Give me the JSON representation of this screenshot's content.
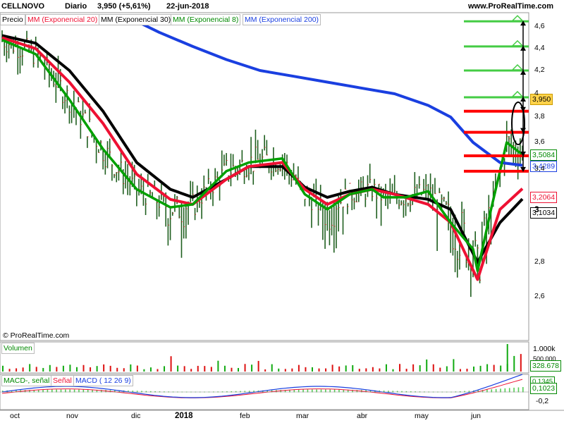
{
  "header": {
    "ticker": "CELLNOVO",
    "period": "Diario",
    "quote": "3,950 (+5,61%)",
    "date": "22-jun-2018",
    "site": "www.ProRealTime.com",
    "copyright": "© ProRealTime.com"
  },
  "legend": {
    "price_label": "Precio",
    "ema20": "MM (Exponencial 20)",
    "ema30": "MM (Exponencial 30)",
    "ema8": "MM (Exponencial 8)",
    "ema200": "MM (Exponencial 200)"
  },
  "volume_pane": {
    "label": "Volumen",
    "ticks": [
      "1.000k",
      "500.000"
    ],
    "last_value": "328.678"
  },
  "macd_pane": {
    "label_macd": "MACD-, señal",
    "label_signal": "Señal",
    "label_params": "MACD ( 12 26 9)",
    "ticks": [
      "-0,2"
    ],
    "value_macd": "0,1345",
    "value_signal": "0,1023"
  },
  "price_labels": {
    "last": "3,950",
    "ema8": "3,5084",
    "ema200": "3,4289",
    "ema20": "3,2064",
    "ema30": "3,1034"
  },
  "colors": {
    "ema8": "#00a000",
    "ema20": "#ee1133",
    "ema30": "#000000",
    "ema200": "#1a3fe0",
    "candles": "#1f5f1f",
    "level_support": "#ff0000",
    "level_target": "#44cc44",
    "last_bg": "#ffd24a"
  },
  "chart_data": {
    "type": "line",
    "x_labels": [
      "oct",
      "nov",
      "dic",
      "2018",
      "feb",
      "mar",
      "abr",
      "may",
      "jun"
    ],
    "y_ticks": [
      "4,6",
      "4,4",
      "4,2",
      "4",
      "3,8",
      "3,6",
      "3,4",
      "3",
      "2,8",
      "2,6"
    ],
    "ylim": [
      2.4,
      4.7
    ],
    "series": [
      {
        "name": "MM (Exponencial 8)",
        "points": [
          [
            0,
            4.48
          ],
          [
            15,
            4.35
          ],
          [
            30,
            3.95
          ],
          [
            45,
            3.55
          ],
          [
            60,
            3.2
          ],
          [
            75,
            3.02
          ],
          [
            85,
            3.05
          ],
          [
            100,
            3.38
          ],
          [
            110,
            3.45
          ],
          [
            125,
            3.48
          ],
          [
            135,
            3.15
          ],
          [
            145,
            3.0
          ],
          [
            155,
            3.15
          ],
          [
            165,
            3.2
          ],
          [
            170,
            3.12
          ],
          [
            180,
            3.12
          ],
          [
            190,
            3.18
          ],
          [
            200,
            2.95
          ],
          [
            210,
            2.85
          ],
          [
            212,
            2.75
          ],
          [
            218,
            3.0
          ],
          [
            225,
            3.6
          ],
          [
            232,
            3.5084
          ]
        ]
      },
      {
        "name": "MM (Exponencial 20)",
        "points": [
          [
            0,
            4.5
          ],
          [
            15,
            4.4
          ],
          [
            30,
            4.1
          ],
          [
            45,
            3.75
          ],
          [
            60,
            3.35
          ],
          [
            75,
            3.1
          ],
          [
            85,
            3.05
          ],
          [
            100,
            3.3
          ],
          [
            110,
            3.42
          ],
          [
            125,
            3.45
          ],
          [
            135,
            3.2
          ],
          [
            145,
            3.05
          ],
          [
            155,
            3.15
          ],
          [
            165,
            3.2
          ],
          [
            175,
            3.15
          ],
          [
            190,
            3.05
          ],
          [
            200,
            2.95
          ],
          [
            212,
            2.7
          ],
          [
            222,
            3.0
          ],
          [
            232,
            3.2064
          ]
        ]
      },
      {
        "name": "MM (Exponencial 30)",
        "points": [
          [
            0,
            4.52
          ],
          [
            15,
            4.45
          ],
          [
            30,
            4.2
          ],
          [
            45,
            3.85
          ],
          [
            60,
            3.45
          ],
          [
            75,
            3.2
          ],
          [
            85,
            3.12
          ],
          [
            100,
            3.3
          ],
          [
            110,
            3.42
          ],
          [
            125,
            3.42
          ],
          [
            135,
            3.22
          ],
          [
            145,
            3.12
          ],
          [
            155,
            3.18
          ],
          [
            165,
            3.22
          ],
          [
            175,
            3.15
          ],
          [
            190,
            3.1
          ],
          [
            200,
            3.0
          ],
          [
            212,
            2.8
          ],
          [
            222,
            2.95
          ],
          [
            232,
            3.1034
          ]
        ]
      },
      {
        "name": "MM (Exponencial 200)",
        "points": [
          [
            55,
            4.7
          ],
          [
            70,
            4.55
          ],
          [
            85,
            4.42
          ],
          [
            100,
            4.3
          ],
          [
            115,
            4.2
          ],
          [
            130,
            4.15
          ],
          [
            145,
            4.1
          ],
          [
            160,
            4.05
          ],
          [
            175,
            4.0
          ],
          [
            190,
            3.9
          ],
          [
            200,
            3.8
          ],
          [
            210,
            3.6
          ],
          [
            222,
            3.45
          ],
          [
            232,
            3.4289
          ]
        ]
      }
    ],
    "horizontal_levels": [
      {
        "kind": "target",
        "value": 4.65
      },
      {
        "kind": "target",
        "value": 4.42
      },
      {
        "kind": "target",
        "value": 4.2
      },
      {
        "kind": "target",
        "value": 3.97
      },
      {
        "kind": "support",
        "value": 3.85
      },
      {
        "kind": "support",
        "value": 3.68
      },
      {
        "kind": "support",
        "value": 3.5
      },
      {
        "kind": "support",
        "value": 3.38
      }
    ],
    "last_close": 3.95
  }
}
